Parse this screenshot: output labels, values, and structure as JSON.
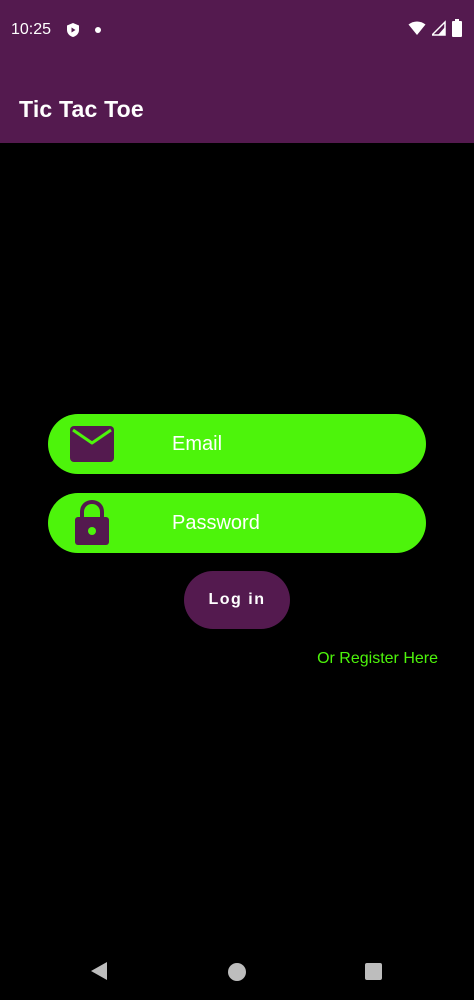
{
  "status_bar": {
    "time": "10:25",
    "icons": [
      "shield-icon",
      "notification-dot-icon",
      "wifi-icon",
      "signal-icon",
      "battery-icon"
    ]
  },
  "app_bar": {
    "title": "Tic Tac Toe"
  },
  "login_form": {
    "email": {
      "placeholder": "Email",
      "value": "",
      "icon": "mail-icon"
    },
    "password": {
      "placeholder": "Password",
      "value": "",
      "icon": "lock-icon"
    },
    "login_label": "Log in",
    "register_label": "Or Register Here"
  },
  "nav_bar": {
    "icons": [
      "back-icon",
      "home-icon",
      "recents-icon"
    ]
  },
  "colors": {
    "primary": "#541a4f",
    "accent": "#4df40b",
    "background": "#000000",
    "on_primary": "#ffffff"
  }
}
